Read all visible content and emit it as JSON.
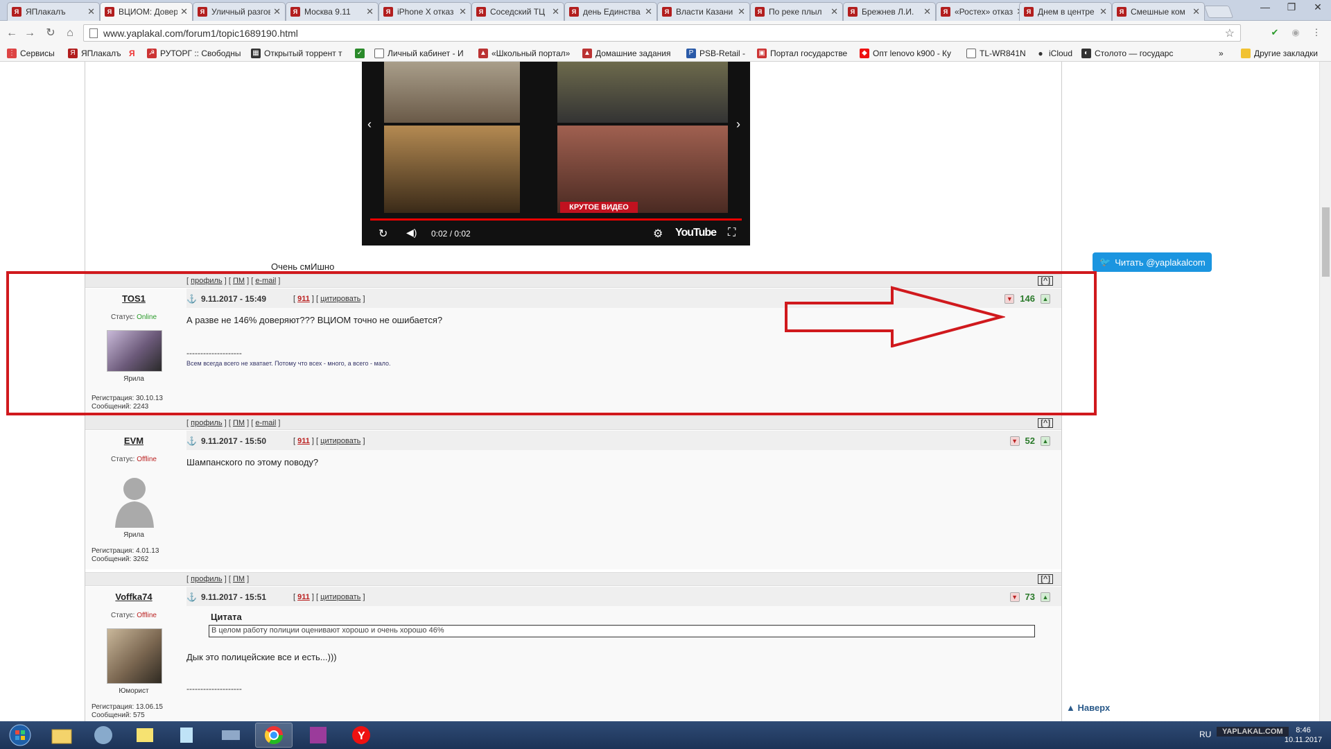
{
  "browser": {
    "tabs": [
      {
        "label": "ЯПлакалъ",
        "active": false
      },
      {
        "label": "ВЦИОМ: Доверие",
        "active": true
      },
      {
        "label": "Уличный разговор",
        "active": false
      },
      {
        "label": "Москва 9.11",
        "active": false
      },
      {
        "label": "iPhone X отказ",
        "active": false
      },
      {
        "label": "Соседский ТЦ",
        "active": false
      },
      {
        "label": "день Единства",
        "active": false
      },
      {
        "label": "Власти Казани",
        "active": false
      },
      {
        "label": "По реке плыл",
        "active": false
      },
      {
        "label": "Брежнев Л.И.",
        "active": false
      },
      {
        "label": "«Ростех» отказ",
        "active": false
      },
      {
        "label": "Днем в центре",
        "active": false
      },
      {
        "label": "Смешные ком",
        "active": false
      }
    ],
    "url": "www.yaplakal.com/forum1/topic1689190.html",
    "bookmarks": [
      {
        "label": "Сервисы"
      },
      {
        "label": "ЯПлакалъ"
      },
      {
        "label": "Я"
      },
      {
        "label": "РУТОРГ :: Свободны"
      },
      {
        "label": "Открытый торрент т"
      },
      {
        "label": ""
      },
      {
        "label": "Личный кабинет - И"
      },
      {
        "label": "«Школьный портал»"
      },
      {
        "label": "Домашние задания"
      },
      {
        "label": "PSB-Retail -"
      },
      {
        "label": "Портал государстве"
      },
      {
        "label": "Опт lenovo k900 - Ку"
      },
      {
        "label": "TL-WR841N"
      },
      {
        "label": "iCloud"
      },
      {
        "label": "Столото — государс"
      }
    ],
    "bookmarks_more": "»",
    "other_bookmarks": "Другие закладки"
  },
  "video": {
    "time": "0:02 / 0:02",
    "youtube_label": "YouTube",
    "banner": "КРУТОЕ ВИДЕО"
  },
  "previous_post_caption": "Очень смИшно",
  "bars": [
    {
      "links": [
        "профиль",
        "ПМ",
        "e-mail"
      ],
      "up": "[^]"
    },
    {
      "links": [
        "профиль",
        "ПМ",
        "e-mail"
      ],
      "up": "[^]"
    },
    {
      "links": [
        "профиль",
        "ПМ"
      ],
      "up": "[^]"
    }
  ],
  "posts": [
    {
      "username": "TOS1",
      "status_label": "Статус:",
      "status_value": "Online",
      "rank": "Ярила",
      "registration": "Регистрация: 30.10.13",
      "messages": "Сообщений: 2243",
      "date": "9.11.2017 - 15:49",
      "num": "911",
      "quote_label": "цитировать",
      "rating": "146",
      "body": "А разве не 146% доверяют??? ВЦИОМ точно не ошибается?",
      "separator": "--------------------",
      "signature": "Всем всегда всего не хватает. Потому что всех - много, а всего - мало."
    },
    {
      "username": "EVM",
      "status_label": "Статус:",
      "status_value": "Offline",
      "rank": "Ярила",
      "registration": "Регистрация: 4.01.13",
      "messages": "Сообщений: 3262",
      "date": "9.11.2017 - 15:50",
      "num": "911",
      "quote_label": "цитировать",
      "rating": "52",
      "body": "Шампанского по этому поводу?"
    },
    {
      "username": "Voffka74",
      "status_label": "Статус:",
      "status_value": "Offline",
      "rank": "Юморист",
      "registration": "Регистрация: 13.06.15",
      "messages": "Сообщений: 575",
      "date": "9.11.2017 - 15:51",
      "num": "911",
      "quote_label": "цитировать",
      "rating": "73",
      "quote_title": "Цитата",
      "quote_text": "В целом работу полиции оценивают хорошо и очень хорошо 46%",
      "body": "Дык это полицейские все и есть...)))",
      "separator": "--------------------"
    }
  ],
  "twitter_button": "Читать @yaplakalcom",
  "to_top": "Наверх",
  "taskbar": {
    "lang": "RU",
    "time": "8:46",
    "date": "10.11.2017",
    "watermark": "YAPLAKAL.COM"
  },
  "colors": {
    "highlight": "#d0191d",
    "twitter": "#1b95e0",
    "online": "#2a9b2a",
    "offline": "#bb2222"
  }
}
